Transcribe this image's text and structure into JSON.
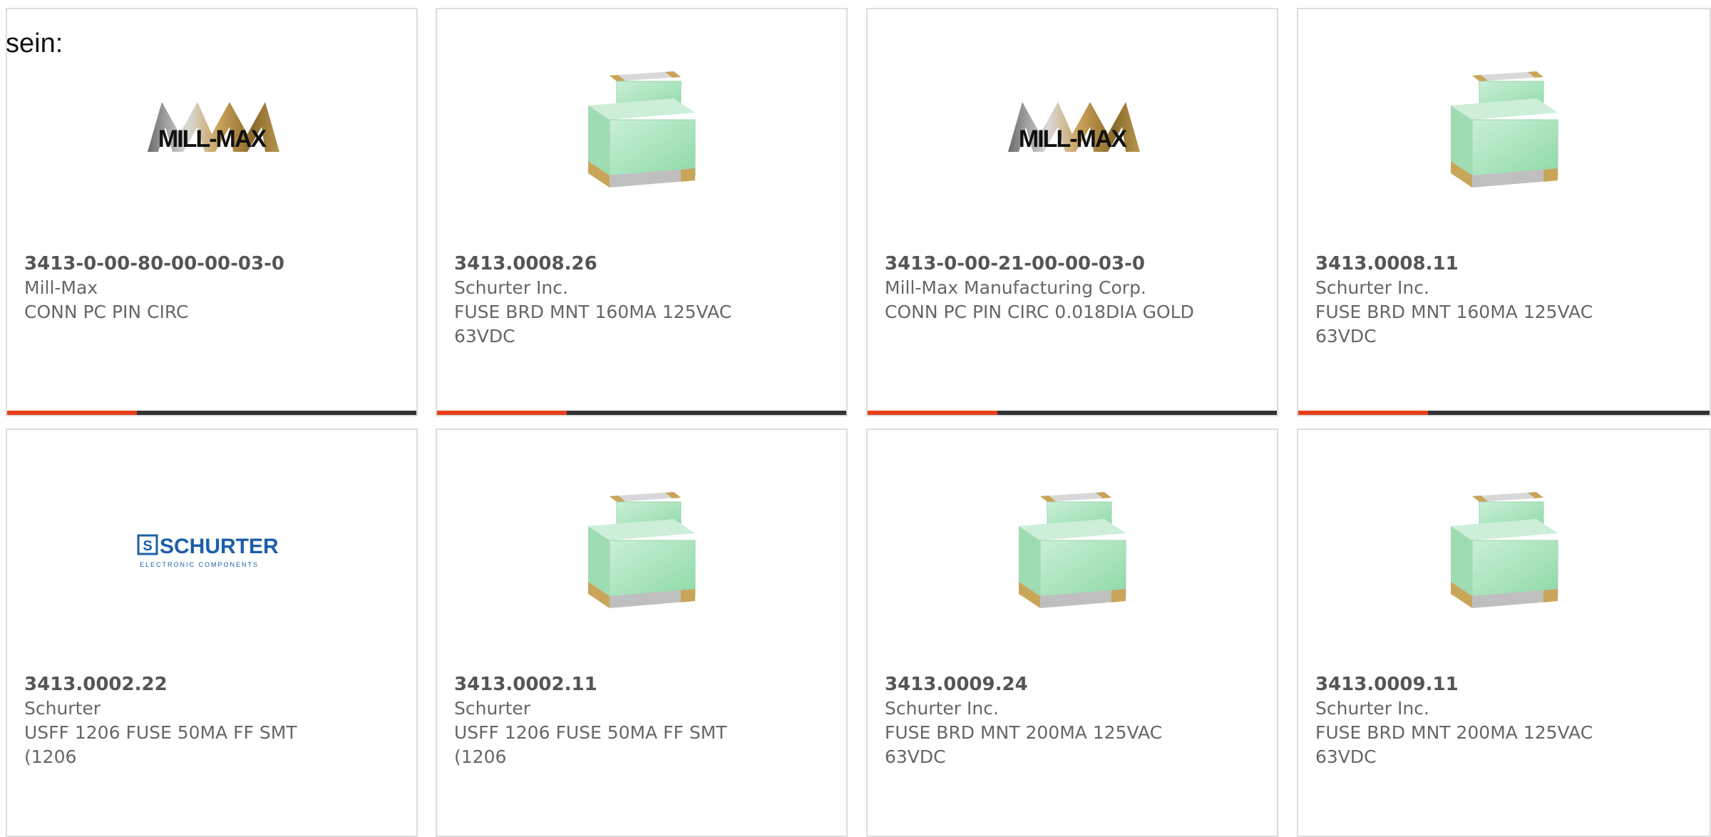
{
  "page": {
    "label": "sein:",
    "accent_color": "#e8401c",
    "bar_color": "#333333"
  },
  "products": [
    {
      "part_number": "3413-0-00-80-00-00-03-0",
      "manufacturer": "Mill-Max",
      "description": "CONN PC PIN CIRC",
      "image": "mill-max-logo"
    },
    {
      "part_number": "3413.0008.26",
      "manufacturer": "Schurter Inc.",
      "description": "FUSE BRD MNT 160MA 125VAC 63VDC",
      "image": "fuse-3d-render"
    },
    {
      "part_number": "3413-0-00-21-00-00-03-0",
      "manufacturer": "Mill-Max Manufacturing Corp.",
      "description": "CONN PC PIN CIRC 0.018DIA GOLD",
      "image": "mill-max-logo"
    },
    {
      "part_number": "3413.0008.11",
      "manufacturer": "Schurter Inc.",
      "description": "FUSE BRD MNT 160MA 125VAC 63VDC",
      "image": "fuse-3d-render"
    },
    {
      "part_number": "3413.0002.22",
      "manufacturer": "Schurter",
      "description": "USFF 1206 FUSE 50MA FF SMT (1206",
      "image": "schurter-logo"
    },
    {
      "part_number": "3413.0002.11",
      "manufacturer": "Schurter",
      "description": "USFF 1206 FUSE 50MA FF SMT (1206",
      "image": "fuse-3d-render"
    },
    {
      "part_number": "3413.0009.24",
      "manufacturer": "Schurter Inc.",
      "description": "FUSE BRD MNT 200MA 125VAC 63VDC",
      "image": "fuse-3d-render"
    },
    {
      "part_number": "3413.0009.11",
      "manufacturer": "Schurter Inc.",
      "description": "FUSE BRD MNT 200MA 125VAC 63VDC",
      "image": "fuse-3d-render"
    }
  ],
  "logos": {
    "millmax_text": "MILL-MAX",
    "schurter_text": "SCHURTER",
    "schurter_sub": "ELECTRONIC COMPONENTS"
  }
}
